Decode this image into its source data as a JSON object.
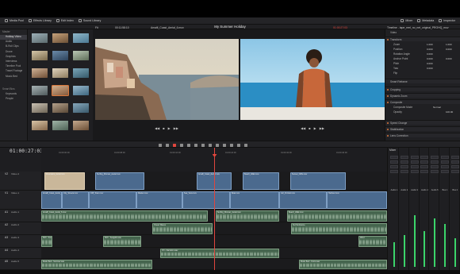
{
  "app": {
    "project_title": "My Summer Holiday",
    "timecode": "01:00:27:03"
  },
  "top_toolbar": {
    "left": [
      "Media Pool",
      "Effects Library",
      "Edit Index",
      "Sound Library"
    ],
    "right": [
      "Mixer",
      "Metadata",
      "Inspector"
    ]
  },
  "secondary_bar": {
    "source_clip": "Amalfi_Coast_Aerial_6.mov",
    "source_timecode": "00:11:58:10",
    "source_fit": "Fit",
    "timeline_name": "Timeline - tape_reel_no_net_original_PROHQ_mov",
    "record_timecode": "01:00:27:03"
  },
  "sidebar": {
    "header": "Master",
    "items": [
      "Holiday Video",
      "Audio",
      "B-Roll Clips",
      "Drone",
      "Graphics",
      "Interviews",
      "Timeline Pool",
      "Travel Footage",
      "Music Bed"
    ],
    "selected": 0,
    "smart_bins_header": "Smart Bins",
    "smart_bins": [
      "Keywords",
      "People"
    ]
  },
  "inspector": {
    "title": "Video",
    "sections": [
      "Transform",
      "Smart Reframe",
      "Cropping",
      "Dynamic Zoom",
      "Composite",
      "Speed Change",
      "Stabilization",
      "Lens Correction"
    ],
    "params": [
      {
        "label": "Zoom",
        "x": "1.000",
        "y": "1.000"
      },
      {
        "label": "Position",
        "x": "0.000",
        "y": "0.000"
      },
      {
        "label": "Rotation Angle",
        "x": "0.000",
        "y": ""
      },
      {
        "label": "Anchor Point",
        "x": "0.000",
        "y": "0.000"
      },
      {
        "label": "Pitch",
        "x": "0.000",
        "y": ""
      },
      {
        "label": "Yaw",
        "x": "0.000",
        "y": ""
      },
      {
        "label": "Flip",
        "x": "",
        "y": ""
      }
    ],
    "composite_mode": "Normal",
    "opacity": "100.00"
  },
  "ruler_ticks": [
    "01:00:00:00",
    "01:00:08:00",
    "01:00:16:00",
    "01:00:24:00",
    "01:00:32:00",
    "01:00:40:00"
  ],
  "tracks": {
    "video": [
      {
        "id": "V2",
        "name": "Video 2"
      },
      {
        "id": "V1",
        "name": "Video 1"
      }
    ],
    "audio": [
      {
        "id": "A1",
        "name": "Audio 1"
      },
      {
        "id": "A2",
        "name": "Audio 2"
      },
      {
        "id": "A3",
        "name": "Audio 3"
      },
      {
        "id": "A4",
        "name": "Audio 4"
      },
      {
        "id": "A5",
        "name": "Audio 5"
      }
    ]
  },
  "clips": {
    "v2": [
      "Mountains_Aerial.mov",
      "Surfing_Woman_Aerial.mov",
      "Amalfi_Coast_Aerial.mov",
      "Beach_Walk.mov",
      "Sunset_Cliffs.mov",
      "Lighthouse.mov"
    ],
    "v1": [
      "Amalfi_Coast_Aerial_6.mov",
      "City_Streets.mov",
      "Cliff_Town.mov",
      "Market.mov",
      "Sea_View.mov",
      "Boat.mov",
      "Girl_Portrait.mov",
      "Harbour.mov"
    ],
    "a1": [
      "Amalfi_Coast_Aerial_6.mov",
      "Surfing_Woman_Aerial.mov",
      "Beach_Walk.mov"
    ],
    "a2": [
      "Ocean Waves",
      "Surf Ambience"
    ],
    "a3": [
      "SFX - Footsteps.wav",
      "SFX - Seagulls.wav",
      "Wind"
    ],
    "a4": [
      "VO - Narration.wav",
      "VO - Intro.wav"
    ],
    "a5": [
      "Music Bed - Summer.wav",
      "Music Bed - Outro.wav"
    ]
  },
  "mixer": {
    "title": "Mixer",
    "channels": [
      "Audio 1",
      "Audio 2",
      "Audio 3",
      "Audio 4",
      "Audio 5",
      "Bus 1",
      "Bus 2"
    ],
    "levels": [
      0.35,
      0.45,
      0.72,
      0.5,
      0.68,
      0.6,
      0.4
    ],
    "meter_color": "#3bd46a"
  },
  "colors": {
    "video_clip": "#4b6a8e",
    "audio_clip": "#45654e",
    "playhead": "#e0463e",
    "accent": "#d9773b"
  }
}
